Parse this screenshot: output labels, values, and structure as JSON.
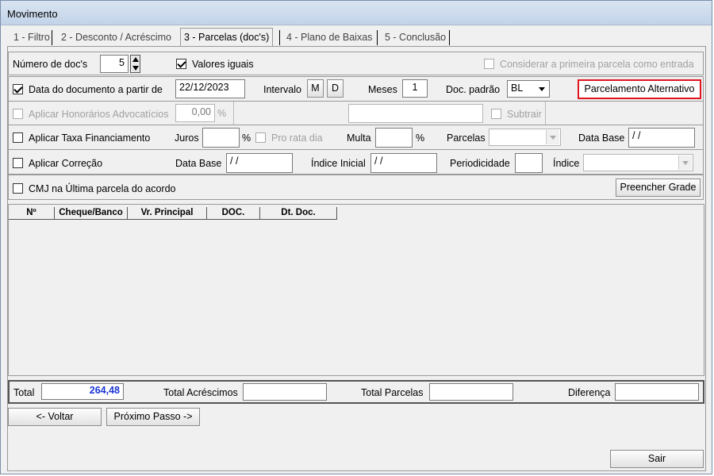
{
  "window": {
    "title": "Movimento"
  },
  "tabs": [
    {
      "label": "1 - Filtro"
    },
    {
      "label": "2 - Desconto / Acréscimo"
    },
    {
      "label": "3 - Parcelas (doc's)"
    },
    {
      "label": "4 - Plano de Baixas"
    },
    {
      "label": "5 - Conclusão"
    }
  ],
  "row1": {
    "num_docs_label": "Número de doc's",
    "num_docs_value": "5",
    "valores_iguais_label": "Valores iguais",
    "considerar_label": "Considerar a primeira parcela como entrada"
  },
  "row2": {
    "data_doc_label": "Data do documento a partir de",
    "data_doc_value": "22/12/2023",
    "intervalo_label": "Intervalo",
    "m_label": "M",
    "d_label": "D",
    "meses_label": "Meses",
    "meses_value": "1",
    "doc_padrao_label": "Doc. padrão",
    "doc_padrao_value": "BL",
    "parcelamento_alt_label": "Parcelamento Alternativo",
    "highlight_color": "#e0141e"
  },
  "row3": {
    "honorarios_label": "Aplicar Honorários Advocatícios",
    "honorarios_value": "0,00",
    "percent": "%",
    "subtrair_label": "Subtrair"
  },
  "row4": {
    "taxa_label": "Aplicar Taxa Financiamento",
    "juros_label": "Juros",
    "percent": "%",
    "pro_rata_label": "Pro rata dia",
    "multa_label": "Multa",
    "parcelas_label": "Parcelas",
    "data_base_label": "Data Base",
    "data_base_value": " / /"
  },
  "row5": {
    "correcao_label": "Aplicar Correção",
    "data_base_label": "Data Base",
    "data_base_value": " / /",
    "indice_inicial_label": "Índice Inicial",
    "indice_inicial_value": " / /",
    "periodicidade_label": "Periodicidade",
    "indice_label": "Índice"
  },
  "row6": {
    "cmj_label": "CMJ na Última parcela do acordo",
    "preencher_label": "Preencher Grade"
  },
  "grid": {
    "columns": [
      "Nº",
      "Cheque/Banco",
      "Vr. Principal",
      "DOC.",
      "Dt. Doc."
    ]
  },
  "totals": {
    "total_label": "Total",
    "total_value": "264,48",
    "total_color": "#1a35d6",
    "acrescimos_label": "Total Acréscimos",
    "parcelas_label": "Total Parcelas",
    "diferenca_label": "Diferença"
  },
  "nav": {
    "voltar_label": "<- Voltar",
    "proximo_label": "Próximo Passo ->",
    "sair_label": "Sair"
  }
}
